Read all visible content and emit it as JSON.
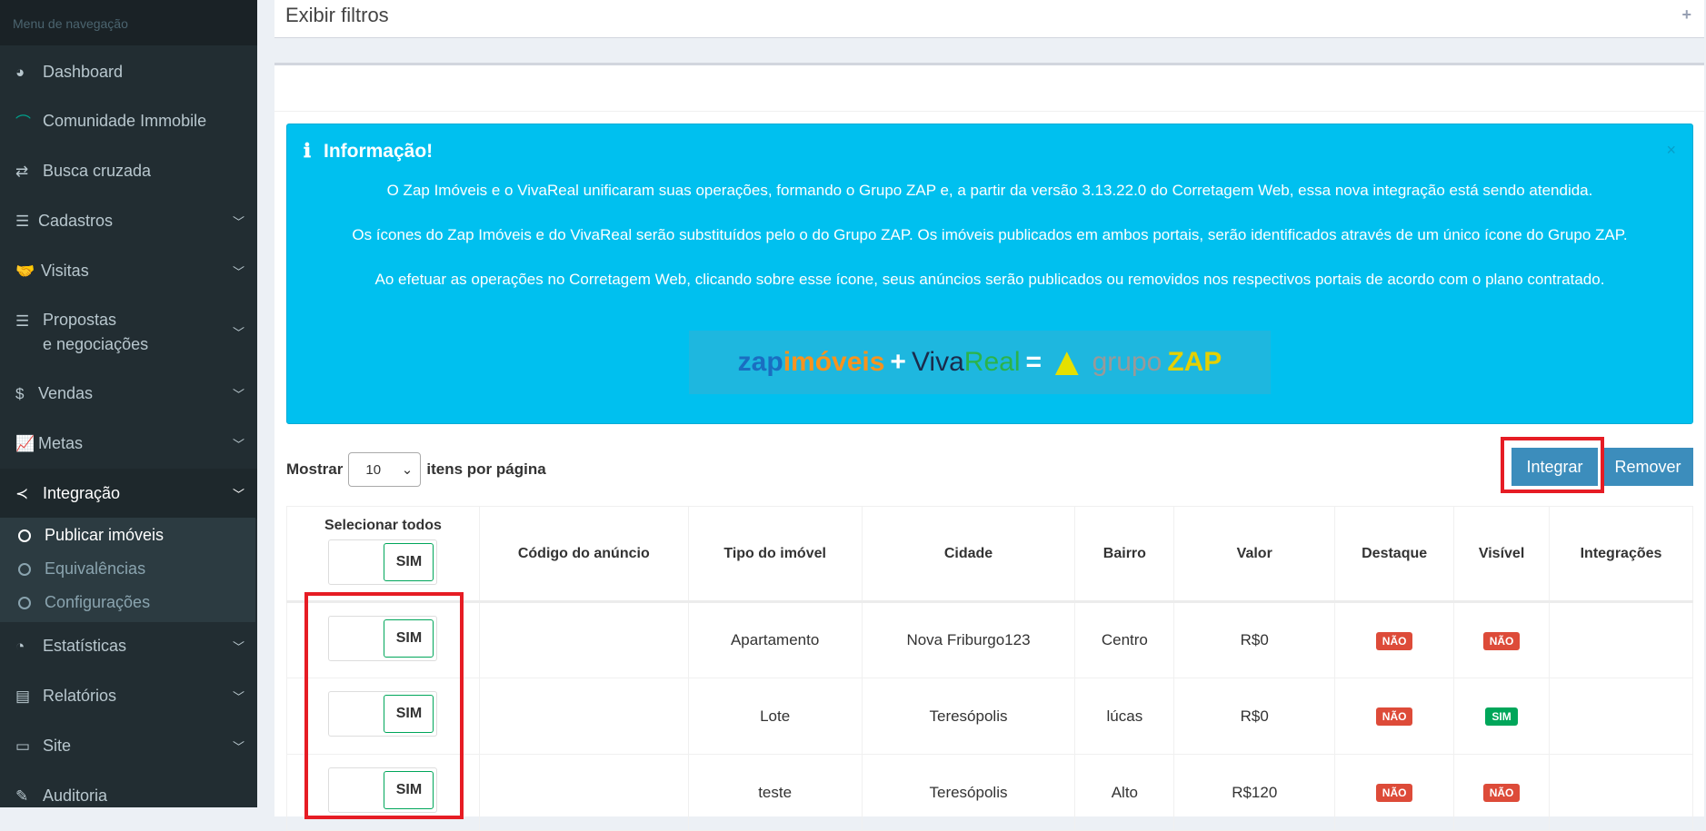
{
  "sidebar": {
    "header": "Menu de navegação",
    "items": [
      {
        "label": "Dashboard",
        "icon": "dashboard-icon"
      },
      {
        "label": "Comunidade Immobile",
        "icon": "house-icon"
      },
      {
        "label": "Busca cruzada",
        "icon": "exchange-icon"
      },
      {
        "label": "Cadastros",
        "icon": "list-icon"
      },
      {
        "label": "Visitas",
        "icon": "handshake-icon"
      },
      {
        "label": "Propostas",
        "label2": "e negociações",
        "icon": "list-icon"
      },
      {
        "label": "Vendas",
        "icon": "dollar-icon"
      },
      {
        "label": "Metas",
        "icon": "line-chart-icon"
      },
      {
        "label": "Integração",
        "icon": "share-icon"
      },
      {
        "label": "Estatísticas",
        "icon": "pie-chart-icon"
      },
      {
        "label": "Relatórios",
        "icon": "file-icon"
      },
      {
        "label": "Site",
        "icon": "laptop-icon"
      },
      {
        "label": "Auditoria",
        "icon": "edit-icon"
      }
    ],
    "subitems": [
      "Publicar imóveis",
      "Equivalências",
      "Configurações"
    ]
  },
  "filters": {
    "title": "Exibir filtros",
    "plus": "+"
  },
  "info": {
    "title": "Informação!",
    "close": "×",
    "p1": "O Zap Imóveis e o VivaReal unificaram suas operações, formando o Grupo ZAP e, a partir da versão 3.13.22.0 do Corretagem Web, essa nova integração está sendo atendida.",
    "p2": "Os ícones do Zap Imóveis e do VivaReal serão substituídos pelo o do Grupo ZAP. Os imóveis publicados em ambos portais, serão identificados através de um único ícone do Grupo ZAP.",
    "p3": "Ao efetuar as operações no Corretagem Web, clicando sobre esse ícone, seus anúncios serão publicados ou removidos nos respectivos portais de acordo com o plano contratado.",
    "logo": {
      "zap": "zap",
      "imoveis": "imóveis",
      "plus": "+",
      "viva": "Viva",
      "real": "Real",
      "eq": "=",
      "grupo": "grupo",
      "zapg": "ZAP"
    }
  },
  "paging": {
    "show": "Mostrar",
    "value": "10",
    "suffix": "itens por página"
  },
  "actions": {
    "integrar": "Integrar",
    "remover": "Remover"
  },
  "table": {
    "select_all": "Selecionar todos",
    "toggle": "SIM",
    "headers": [
      "Código do anúncio",
      "Tipo do imóvel",
      "Cidade",
      "Bairro",
      "Valor",
      "Destaque",
      "Visível",
      "Integrações"
    ],
    "rows": [
      {
        "codigo": "",
        "tipo": "Apartamento",
        "cidade": "Nova Friburgo123",
        "bairro": "Centro",
        "valor": "R$0",
        "destaque": "NÃO",
        "visivel": "NÃO"
      },
      {
        "codigo": "",
        "tipo": "Lote",
        "cidade": "Teresópolis",
        "bairro": "lúcas",
        "valor": "R$0",
        "destaque": "NÃO",
        "visivel": "SIM"
      },
      {
        "codigo": "",
        "tipo": "teste",
        "cidade": "Teresópolis",
        "bairro": "Alto",
        "valor": "R$120",
        "destaque": "NÃO",
        "visivel": "NÃO"
      }
    ]
  }
}
